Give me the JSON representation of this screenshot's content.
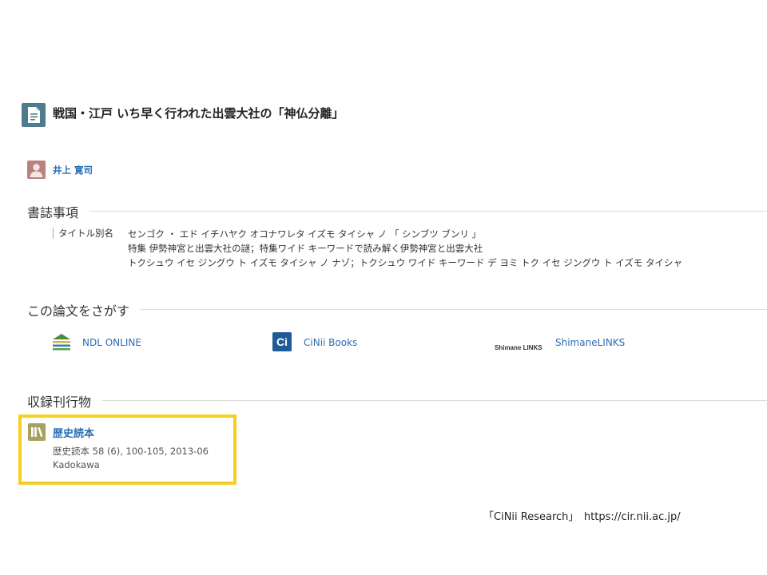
{
  "header": {
    "title": "戦国・江戸 いち早く行われた出雲大社の「神仏分離」",
    "icon": "article-icon"
  },
  "author": {
    "name": "井上 寛司",
    "icon": "person-avatar-icon"
  },
  "bibliography": {
    "heading": "書誌事項",
    "alt_title_label": "タイトル別名",
    "alt_titles": [
      "センゴク ・ エド イチハヤク オコナワレタ イズモ タイシャ ノ 「 シンブツ ブンリ 」",
      "特集 伊勢神宮と出雲大社の謎；特集ワイド キーワードで読み解く伊勢神宮と出雲大社",
      "トクシュウ イセ ジングウ ト イズモ タイシャ ノ ナゾ；トクシュウ ワイド キーワード デ ヨミ トク イセ ジングウ ト イズモ タイシャ"
    ]
  },
  "find": {
    "heading": "この論文をさがす",
    "links": [
      {
        "label": "NDL ONLINE",
        "icon": "ndl-icon"
      },
      {
        "label": "CiNii Books",
        "icon": "cinii-icon",
        "icon_text": "Ci"
      },
      {
        "label": "ShimaneLINKS",
        "icon": "shimane-links-logo",
        "icon_text": "Shimane LINKS"
      }
    ]
  },
  "journal": {
    "heading": "収録刊行物",
    "title": "歴史読本",
    "citation": "歴史読本 58 (6), 100-105, 2013-06",
    "publisher": "Kadokawa",
    "icon": "books-icon",
    "highlight_color": "#f6cf22"
  },
  "caption": {
    "text": "「CiNii Research」　https://cir.nii.ac.jp/"
  },
  "colors": {
    "link": "#2a6db5",
    "article_icon": "#4f7c8c",
    "avatar": "#b9827f",
    "journal_icon": "#a8a060"
  }
}
